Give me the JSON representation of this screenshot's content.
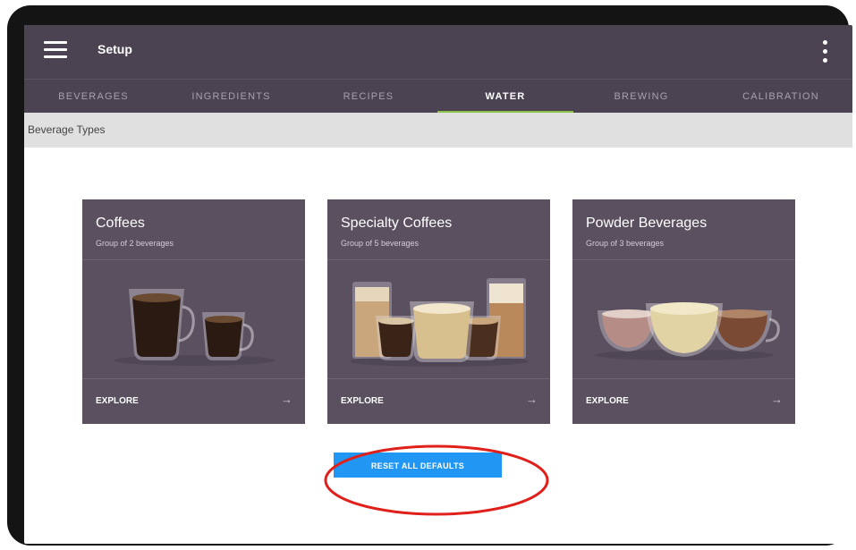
{
  "appbar": {
    "title": "Setup"
  },
  "tabs": [
    {
      "label": "BEVERAGES",
      "active": false
    },
    {
      "label": "INGREDIENTS",
      "active": false
    },
    {
      "label": "RECIPES",
      "active": false
    },
    {
      "label": "WATER",
      "active": true
    },
    {
      "label": "BREWING",
      "active": false
    },
    {
      "label": "CALIBRATION",
      "active": false
    }
  ],
  "subheader": {
    "label": "Beverage Types"
  },
  "cards": [
    {
      "title": "Coffees",
      "subtitle": "Group of 2 beverages",
      "action": "EXPLORE",
      "arrow": "→"
    },
    {
      "title": "Specialty Coffees",
      "subtitle": "Group of 5 beverages",
      "action": "EXPLORE",
      "arrow": "→"
    },
    {
      "title": "Powder Beverages",
      "subtitle": "Group of 3 beverages",
      "action": "EXPLORE",
      "arrow": "→"
    }
  ],
  "reset_button": {
    "label": "RESET ALL DEFAULTS"
  },
  "colors": {
    "appbar": "#4b4351",
    "card": "#5a5060",
    "active_tab_indicator": "#8bc34a",
    "button": "#2196f3",
    "highlight_circle": "#e0201b"
  }
}
